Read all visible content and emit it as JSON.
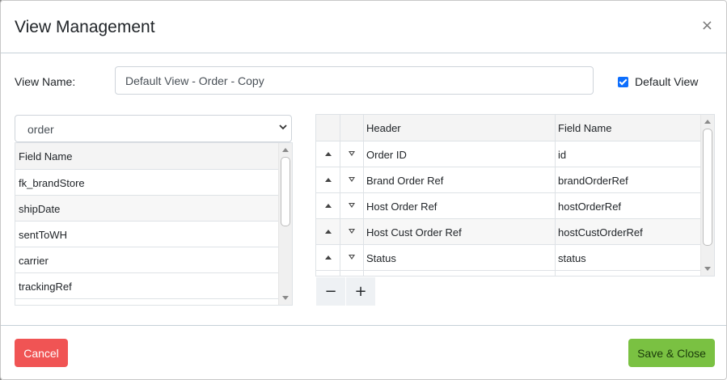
{
  "modal": {
    "title": "View Management",
    "close_glyph": "×"
  },
  "view_name": {
    "label": "View Name:",
    "value": "Default View - Order - Copy"
  },
  "default_view": {
    "label": "Default View",
    "checked": true
  },
  "entity_select": {
    "value": "order"
  },
  "available_fields": {
    "header": "Field Name",
    "rows": [
      "fk_brandStore",
      "shipDate",
      "sentToWH",
      "carrier",
      "trackingRef"
    ]
  },
  "selected_columns": {
    "headers": {
      "header": "Header",
      "field_name": "Field Name"
    },
    "rows": [
      {
        "header": "Order ID",
        "field": "id"
      },
      {
        "header": "Brand Order Ref",
        "field": "brandOrderRef"
      },
      {
        "header": "Host Order Ref",
        "field": "hostOrderRef"
      },
      {
        "header": "Host Cust Order Ref",
        "field": "hostCustOrderRef"
      },
      {
        "header": "Status",
        "field": "status"
      },
      {
        "header": "",
        "field": ""
      }
    ]
  },
  "buttons": {
    "minus": "−",
    "plus": "+",
    "cancel": "Cancel",
    "save": "Save & Close"
  },
  "colors": {
    "cancel": "#f05454",
    "save": "#7ac142",
    "checkbox": "#0d6efd"
  }
}
